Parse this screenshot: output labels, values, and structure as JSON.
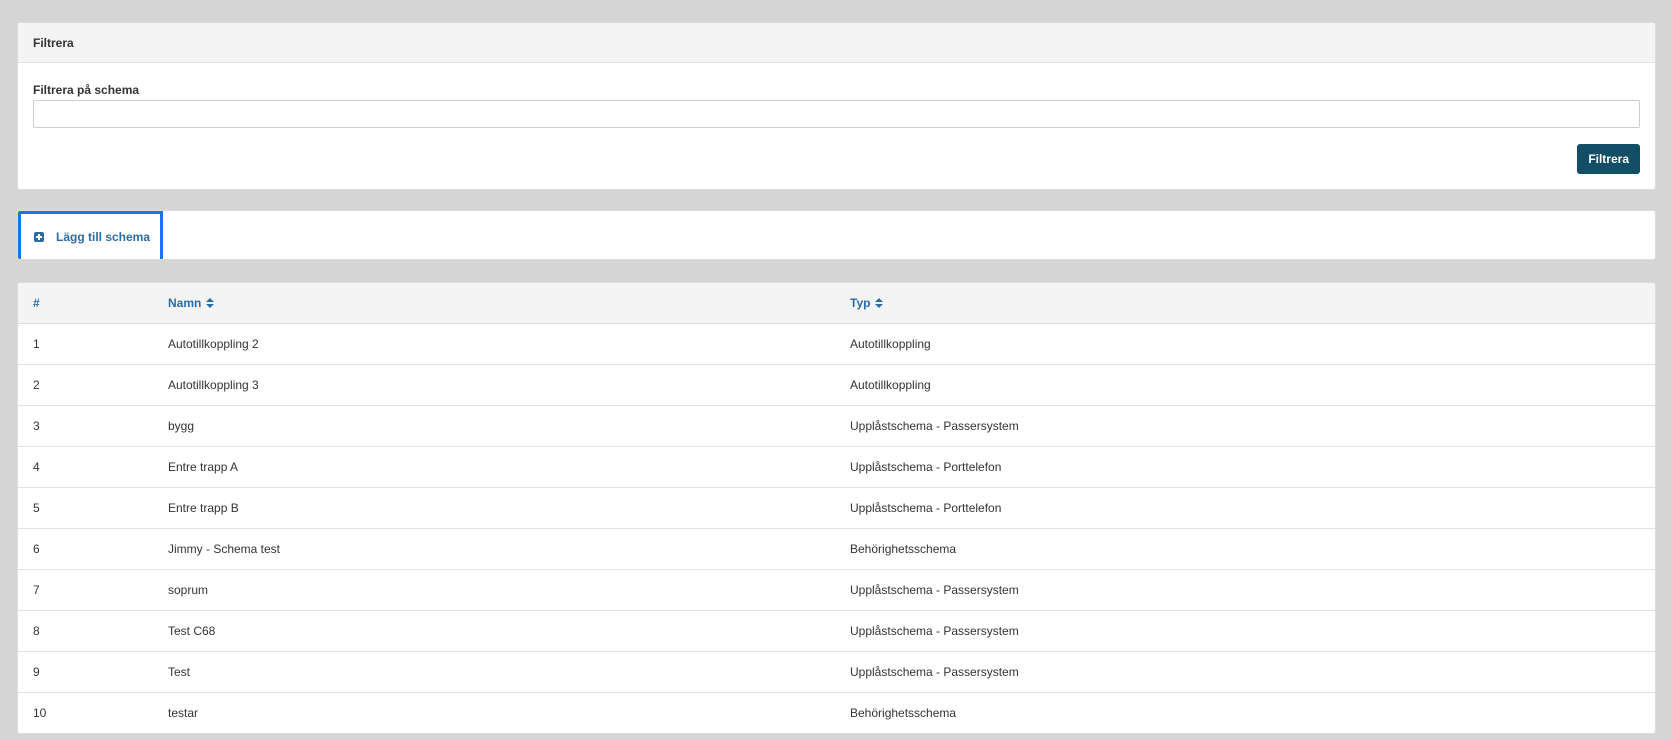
{
  "filter": {
    "heading": "Filtrera",
    "label": "Filtrera på schema",
    "input_value": "",
    "button_label": "Filtrera",
    "button_color": "#124e66"
  },
  "add": {
    "label": "Lägg till schema",
    "icon": "plus-square-icon",
    "link_color": "#2c6ca3"
  },
  "table": {
    "columns": [
      {
        "label": "#",
        "sortable": false
      },
      {
        "label": "Namn",
        "sortable": true
      },
      {
        "label": "Typ",
        "sortable": true
      }
    ],
    "rows": [
      {
        "num": "1",
        "name": "Autotillkoppling 2",
        "type": "Autotillkoppling"
      },
      {
        "num": "2",
        "name": "Autotillkoppling 3",
        "type": "Autotillkoppling"
      },
      {
        "num": "3",
        "name": "bygg",
        "type": "Upplåstschema - Passersystem"
      },
      {
        "num": "4",
        "name": "Entre trapp A",
        "type": "Upplåstschema - Porttelefon"
      },
      {
        "num": "5",
        "name": "Entre trapp B",
        "type": "Upplåstschema - Porttelefon"
      },
      {
        "num": "6",
        "name": "Jimmy - Schema test",
        "type": "Behörighetsschema"
      },
      {
        "num": "7",
        "name": "soprum",
        "type": "Upplåstschema - Passersystem"
      },
      {
        "num": "8",
        "name": "Test C68",
        "type": "Upplåstschema - Passersystem"
      },
      {
        "num": "9",
        "name": "Test",
        "type": "Upplåstschema - Passersystem"
      },
      {
        "num": "10",
        "name": "testar",
        "type": "Behörighetsschema"
      }
    ]
  }
}
